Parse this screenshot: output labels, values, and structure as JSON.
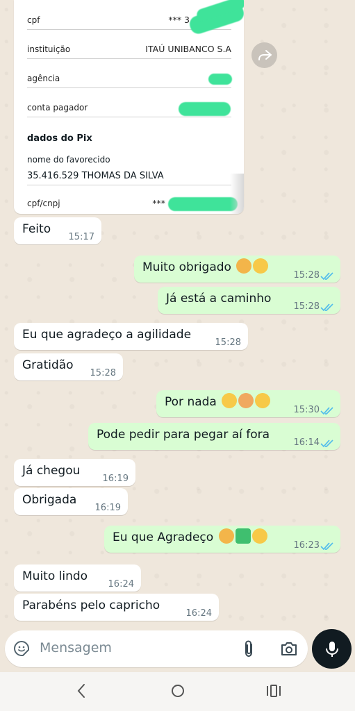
{
  "receipt": {
    "cpf_label": "cpf",
    "cpf_value": "*** 3",
    "instituicao_label": "instituição",
    "instituicao_value": "ITAÚ UNIBANCO S.A",
    "agencia_label": "agência",
    "conta_label": "conta pagador",
    "section_title": "dados do Pix",
    "favorecido_label": "nome do favorecido",
    "favorecido_value": "35.416.529 THOMAS DA SILVA",
    "cpfcnpj_label": "cpf/cnpj",
    "cpfcnpj_value": "***"
  },
  "messages": [
    {
      "dir": "in",
      "text": "Feito",
      "time": "15:17"
    },
    {
      "dir": "out",
      "text": "Muito obrigado",
      "emoji": [
        "praying-hands",
        "party-face"
      ],
      "time": "15:28"
    },
    {
      "dir": "out",
      "text": "Já está a caminho",
      "time": "15:28"
    },
    {
      "dir": "in",
      "text": "Eu que agradeço a agilidade",
      "time": "15:28"
    },
    {
      "dir": "in",
      "text": "Gratidão",
      "time": "15:28"
    },
    {
      "dir": "out",
      "text": "Por nada",
      "emoji": [
        "grinning-face",
        "handshake",
        "party-face"
      ],
      "time": "15:30"
    },
    {
      "dir": "out",
      "text": "Pode pedir para pegar aí fora",
      "time": "16:14"
    },
    {
      "dir": "in",
      "text": "Já chegou",
      "time": "16:19"
    },
    {
      "dir": "in",
      "text": "Obrigada",
      "time": "16:19"
    },
    {
      "dir": "out",
      "text": "Eu que Agradeço",
      "emoji": [
        "praying-hands",
        "check-mark-button",
        "smiling-face"
      ],
      "time": "16:23"
    },
    {
      "dir": "in",
      "text": "Muito lindo",
      "time": "16:24"
    },
    {
      "dir": "in",
      "text": "Parabéns pelo capricho",
      "time": "16:24"
    }
  ],
  "composer": {
    "placeholder": "Mensagem",
    "icons": [
      "sticker-icon",
      "attach-icon",
      "camera-icon",
      "mic-icon"
    ]
  },
  "colors": {
    "background": "#efe7dc",
    "incoming": "#ffffff",
    "outgoing": "#d9fdd3",
    "read_ticks": "#53bdeb",
    "redaction": "#3fe39a"
  }
}
